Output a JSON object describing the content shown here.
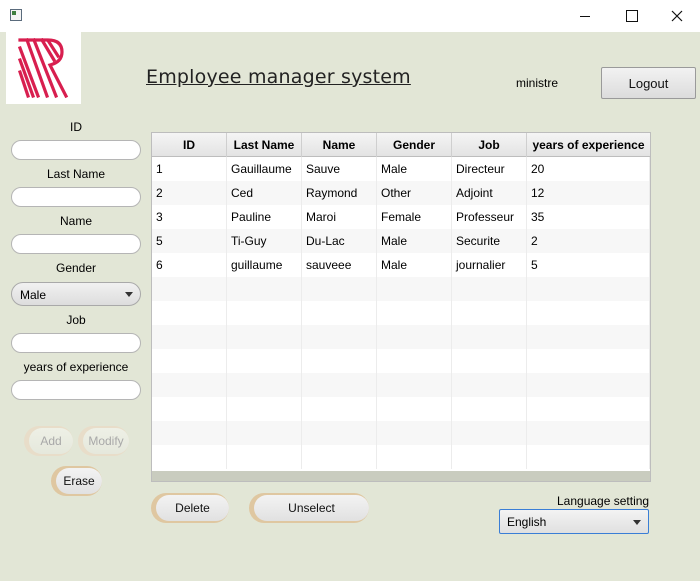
{
  "window": {
    "controls": [
      "minimize",
      "maximize",
      "close"
    ]
  },
  "header": {
    "title": "Employee manager system",
    "user": "ministre",
    "logout_label": "Logout"
  },
  "form": {
    "id_label": "ID",
    "last_name_label": "Last Name",
    "name_label": "Name",
    "gender_label": "Gender",
    "gender_value": "Male",
    "job_label": "Job",
    "experience_label": "years of experience",
    "add_label": "Add",
    "modify_label": "Modify",
    "erase_label": "Erase"
  },
  "table": {
    "columns": [
      "ID",
      "Last Name",
      "Name",
      "Gender",
      "Job",
      "years of experience"
    ],
    "rows": [
      [
        "1",
        "Gauillaume",
        "Sauve",
        "Male",
        "Directeur",
        "20"
      ],
      [
        "2",
        "Ced",
        "Raymond",
        "Other",
        "Adjoint",
        "12"
      ],
      [
        "3",
        "Pauline",
        "Maroi",
        "Female",
        "Professeur",
        "35"
      ],
      [
        "5",
        "Ti-Guy",
        "Du-Lac",
        "Male",
        "Securite",
        "2"
      ],
      [
        "6",
        "guillaume",
        "sauveee",
        "Male",
        "journalier",
        "5"
      ]
    ]
  },
  "actions": {
    "delete_label": "Delete",
    "unselect_label": "Unselect"
  },
  "language": {
    "label": "Language setting",
    "value": "English"
  },
  "colors": {
    "background": "#e2e6d6",
    "accent_button": "#dfc7a1",
    "logo": "#d81f4f",
    "focus_border": "#3a7ed6"
  },
  "icons": {
    "logo": "r-chevron-logo",
    "window": "app-window-icon"
  }
}
